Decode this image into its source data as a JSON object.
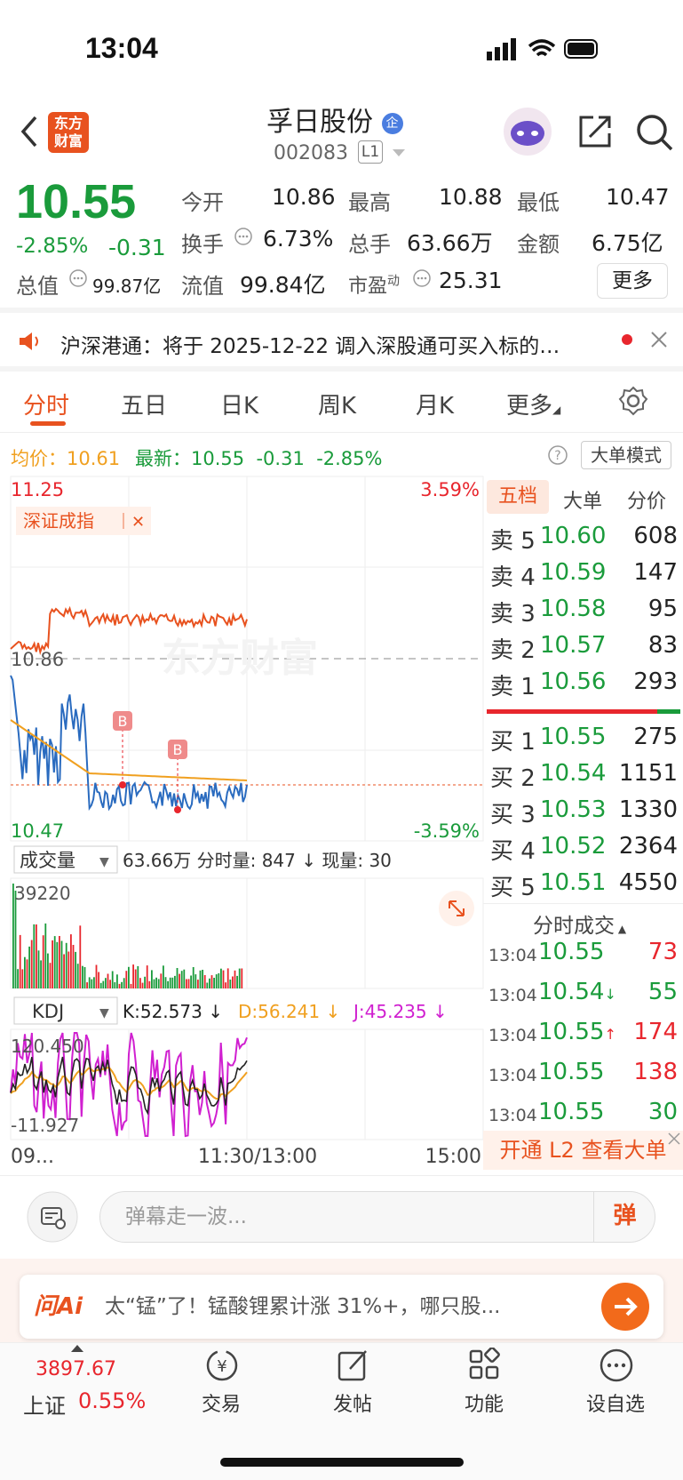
{
  "status": {
    "time": "13:04"
  },
  "header": {
    "logo_text_line1": "东方",
    "logo_text_line2": "财富",
    "title": "孚日股份",
    "title_badge": "企",
    "code": "002083",
    "level": "L1"
  },
  "quote": {
    "price": "10.55",
    "change_pct": "-2.85%",
    "change": "-0.31",
    "open_label": "今开",
    "open": "10.86",
    "high_label": "最高",
    "high": "10.88",
    "low_label": "最低",
    "low": "10.47",
    "turnover_label": "换手",
    "turnover": "6.73%",
    "volume_label": "总手",
    "volume": "63.66万",
    "amount_label": "金额",
    "amount": "6.75亿",
    "mcap_label": "总值",
    "mcap": "99.87亿",
    "float_label": "流值",
    "float": "99.84亿",
    "pe_label": "市盈",
    "pe_sup": "动",
    "pe": "25.31",
    "more": "更多"
  },
  "notice": {
    "text": "沪深港通：将于 2025-12-22 调入深股通可买入标的…"
  },
  "tabs": [
    "分时",
    "五日",
    "日K",
    "周K",
    "月K",
    "更多"
  ],
  "info": {
    "avg_label": "均价：",
    "avg": "10.61",
    "latest_label": "最新：",
    "latest": "10.55",
    "chg": "-0.31",
    "pct": "-2.85%",
    "mode": "大单模式"
  },
  "chart_labels": {
    "top_price": "11.25",
    "top_pct": "3.59%",
    "mid_price": "10.86",
    "bot_price": "10.47",
    "bot_pct": "-3.59%",
    "index_tag": "深证成指",
    "watermark": "东方财富",
    "marker": "B",
    "vol_selector": "成交量",
    "vol_info": "63.66万 分时量: 847 ↓ 现量: 30",
    "vol_max": "39220",
    "kdj_selector": "KDJ",
    "kdj_k": "K:52.573 ↓",
    "kdj_d": "D:56.241 ↓",
    "kdj_j": "J:45.235 ↓",
    "kdj_top": "120.450",
    "kdj_bot": "-11.927",
    "x_start": "09...",
    "x_mid": "11:30/13:00",
    "x_end": "15:00"
  },
  "order_book": {
    "tabs": [
      "五档",
      "大单",
      "分价"
    ],
    "sells": [
      {
        "label": "卖 5",
        "price": "10.60",
        "vol": "608"
      },
      {
        "label": "卖 4",
        "price": "10.59",
        "vol": "147"
      },
      {
        "label": "卖 3",
        "price": "10.58",
        "vol": "95"
      },
      {
        "label": "卖 2",
        "price": "10.57",
        "vol": "83"
      },
      {
        "label": "卖 1",
        "price": "10.56",
        "vol": "293"
      }
    ],
    "buys": [
      {
        "label": "买 1",
        "price": "10.55",
        "vol": "275"
      },
      {
        "label": "买 2",
        "price": "10.54",
        "vol": "1151"
      },
      {
        "label": "买 3",
        "price": "10.53",
        "vol": "1330"
      },
      {
        "label": "买 4",
        "price": "10.52",
        "vol": "2364"
      },
      {
        "label": "买 5",
        "price": "10.51",
        "vol": "4550"
      }
    ],
    "trades_title": "分时成交",
    "trades": [
      {
        "time": "13:04",
        "price": "10.55",
        "vol": "73"
      },
      {
        "time": "13:04",
        "price": "10.54",
        "arrow": "↓",
        "vol": "55"
      },
      {
        "time": "13:04",
        "price": "10.55",
        "arrow": "↑",
        "vol": "174"
      },
      {
        "time": "13:04",
        "price": "10.55",
        "vol": "138"
      },
      {
        "time": "13:04",
        "price": "10.55",
        "vol": "30"
      }
    ],
    "l2_button": "开通 L2 查看大单"
  },
  "danmu": {
    "placeholder": "弹幕走一波...",
    "btn": "弹"
  },
  "ai": {
    "brand": "问Ai",
    "text": "太“锰”了！锰酸锂累计涨 31%+，哪只股..."
  },
  "tabbar": {
    "index_value": "3897.67",
    "index_name": "上证",
    "index_pct": "0.55%",
    "items": [
      "交易",
      "发帖",
      "功能",
      "设自选"
    ]
  },
  "colors": {
    "up": "#e8262d",
    "down": "#1a9b3b",
    "accent": "#e8521f",
    "avg_line": "#f0a020",
    "kdj_j": "#d020d0"
  }
}
